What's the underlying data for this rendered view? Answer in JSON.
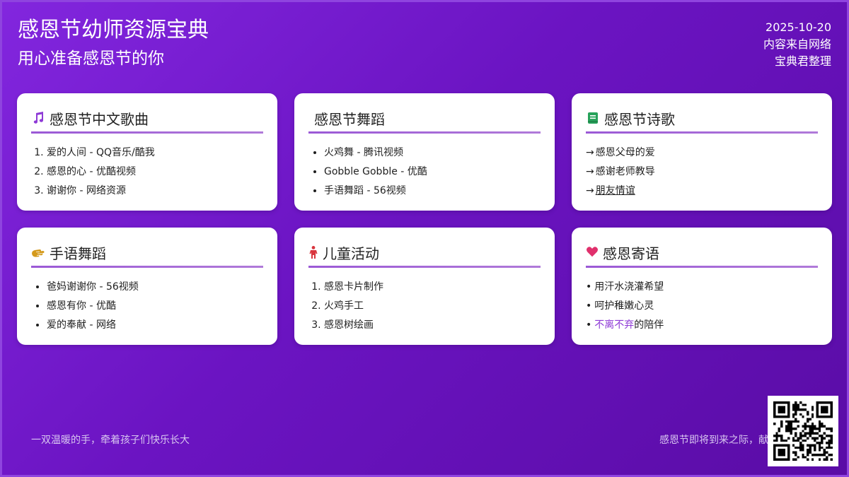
{
  "header": {
    "title": "感恩节幼师资源宝典",
    "subtitle": "用心准备感恩节的你",
    "date": "2025-10-20",
    "source": "内容来自网络",
    "editor": "宝典君整理"
  },
  "cards": [
    {
      "title": "感恩节中文歌曲",
      "icon": "music-note-icon",
      "items": [
        "爱的人间 - QQ音乐/酷我",
        "感恩的心 - 优酷视频",
        "谢谢你 - 网络资源"
      ]
    },
    {
      "title": "感恩节舞蹈",
      "items": [
        "火鸡舞 - 腾讯视频",
        "Gobble Gobble - 优酷",
        "手语舞蹈 - 56视频"
      ]
    },
    {
      "title": "感恩节诗歌",
      "icon": "book-icon",
      "items": [
        "感恩父母的爱",
        "感谢老师教导",
        "朋友情谊"
      ]
    },
    {
      "title": "手语舞蹈",
      "icon": "hand-icon",
      "items": [
        "爸妈谢谢你 - 56视频",
        "感恩有你 - 优酷",
        "爱的奉献 - 网络"
      ]
    },
    {
      "title": "儿童活动",
      "icon": "child-icon",
      "items": [
        "感恩卡片制作",
        "火鸡手工",
        "感恩树绘画"
      ]
    },
    {
      "title": "感恩寄语",
      "icon": "heart-icon",
      "items": [
        "用汗水浇灌希望",
        "呵护稚嫩心灵",
        "的陪伴"
      ],
      "highlight": "不离不弃"
    }
  ],
  "footer": {
    "left": "一双温暖的手，牵着孩子们快乐长大",
    "right": "感恩节即将到来之际，献给"
  },
  "qr": {
    "icon": "qr-code-icon"
  },
  "colors": {
    "background_start": "#8226de",
    "background_end": "#5a0ca6",
    "accent": "#9b59d6",
    "highlight": "#8e3ad6",
    "music_icon": "#8e3ad6",
    "book_icon": "#27a25a",
    "hand_icon": "#d49a1c",
    "child_icon": "#d9363e",
    "heart_icon": "#e0306c"
  }
}
